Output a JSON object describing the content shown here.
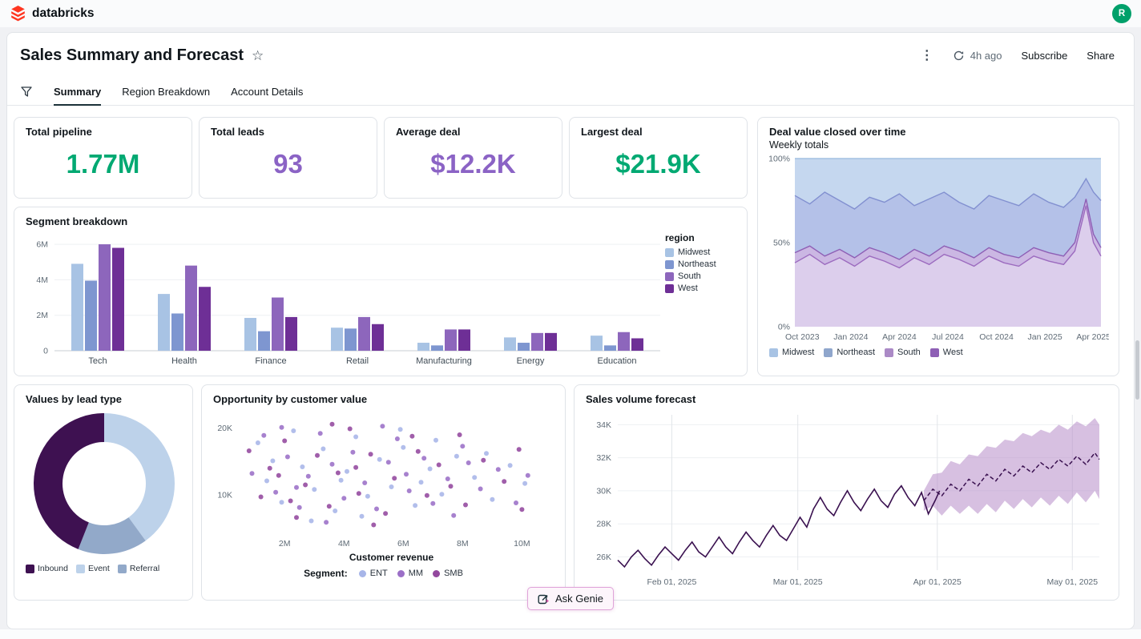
{
  "colors": {
    "brand_red": "#FF3621",
    "avatar_green": "#00A06A",
    "tab_underline": "#1B3139",
    "card_border": "#DFE3E8",
    "genie_border": "#DFA3D9",
    "genie_bg": "#FDF5FB",
    "text_primary": "#11171C",
    "text_secondary": "#5F6B76"
  },
  "topbar": {
    "brand": "databricks",
    "avatar_initial": "R"
  },
  "header": {
    "title": "Sales Summary and Forecast",
    "refreshed": "4h ago",
    "subscribe": "Subscribe",
    "share": "Share"
  },
  "tabs": [
    {
      "label": "Summary"
    },
    {
      "label": "Region Breakdown"
    },
    {
      "label": "Account Details"
    }
  ],
  "kpis": [
    {
      "title": "Total pipeline",
      "value": "1.77M",
      "color": "#00A972"
    },
    {
      "title": "Total leads",
      "value": "93",
      "color": "#8B63C5"
    },
    {
      "title": "Average deal",
      "value": "$12.2K",
      "color": "#8B63C5"
    },
    {
      "title": "Largest deal",
      "value": "$21.9K",
      "color": "#00A972"
    }
  ],
  "ask_genie": {
    "label": "Ask Genie"
  },
  "chart_data": [
    {
      "id": "segment-breakdown",
      "type": "bar",
      "title": "Segment breakdown",
      "legend_title": "region",
      "categories": [
        "Tech",
        "Health",
        "Finance",
        "Retail",
        "Manufacturing",
        "Energy",
        "Education"
      ],
      "series": [
        {
          "name": "Midwest",
          "color": "#A8C3E4",
          "values": [
            4.9,
            3.2,
            1.85,
            1.3,
            0.45,
            0.75,
            0.85
          ]
        },
        {
          "name": "Northeast",
          "color": "#7E96D0",
          "values": [
            3.95,
            2.1,
            1.1,
            1.25,
            0.3,
            0.45,
            0.3
          ]
        },
        {
          "name": "South",
          "color": "#8D66BC",
          "values": [
            6.0,
            4.8,
            3.0,
            1.9,
            1.2,
            1.0,
            1.05
          ]
        },
        {
          "name": "West",
          "color": "#6E2F96",
          "values": [
            5.8,
            3.6,
            1.9,
            1.5,
            1.2,
            1.0,
            0.7
          ]
        }
      ],
      "y_ticks": [
        0,
        2,
        4,
        6
      ],
      "y_tick_labels": [
        "0",
        "2M",
        "4M",
        "6M"
      ],
      "ylim": [
        0,
        6.5
      ]
    },
    {
      "id": "deal-value-closed",
      "type": "area",
      "title": "Deal value closed over time",
      "subtitle": "Weekly totals",
      "stack_bottom_to_top": [
        "West",
        "South",
        "Northeast",
        "Midwest"
      ],
      "x": [
        0,
        4,
        8,
        12,
        16,
        20,
        24,
        28,
        32,
        36,
        40,
        44,
        48,
        52,
        56,
        60,
        64,
        68,
        72,
        75,
        78,
        80,
        82
      ],
      "cum": {
        "west_top": [
          0.38,
          0.43,
          0.37,
          0.41,
          0.36,
          0.42,
          0.39,
          0.35,
          0.41,
          0.37,
          0.43,
          0.4,
          0.36,
          0.42,
          0.38,
          0.36,
          0.42,
          0.39,
          0.37,
          0.45,
          0.72,
          0.5,
          0.42
        ],
        "south_top": [
          0.44,
          0.48,
          0.42,
          0.46,
          0.41,
          0.47,
          0.44,
          0.4,
          0.46,
          0.42,
          0.48,
          0.45,
          0.41,
          0.47,
          0.43,
          0.41,
          0.47,
          0.44,
          0.42,
          0.5,
          0.76,
          0.55,
          0.47
        ],
        "northeast_top": [
          0.78,
          0.73,
          0.8,
          0.75,
          0.7,
          0.77,
          0.74,
          0.79,
          0.72,
          0.76,
          0.8,
          0.74,
          0.7,
          0.78,
          0.75,
          0.72,
          0.79,
          0.74,
          0.71,
          0.77,
          0.88,
          0.8,
          0.75
        ]
      },
      "xlim": [
        0,
        82
      ],
      "x_ticks": [
        {
          "pos": 2,
          "label": "Oct 2023"
        },
        {
          "pos": 15,
          "label": "Jan 2024"
        },
        {
          "pos": 28,
          "label": "Apr 2024"
        },
        {
          "pos": 41,
          "label": "Jul 2024"
        },
        {
          "pos": 54,
          "label": "Oct 2024"
        },
        {
          "pos": 67,
          "label": "Jan 2025"
        },
        {
          "pos": 80,
          "label": "Apr 2025"
        }
      ],
      "y_tick_labels": [
        "0%",
        "50%",
        "100%"
      ],
      "band_fills": [
        "#DCCEEC",
        "#CBB7E3",
        "#B4C1E8",
        "#C5D7EF"
      ],
      "band_strokes": [
        "#9C6BBF",
        "#8E5FB5",
        "#8290D0",
        "#A4C0E2"
      ],
      "legend": [
        {
          "label": "Midwest",
          "color": "#A8C3E4"
        },
        {
          "label": "Northeast",
          "color": "#8FA6CC"
        },
        {
          "label": "South",
          "color": "#AB8AC6"
        },
        {
          "label": "West",
          "color": "#8E5FB5"
        }
      ]
    },
    {
      "id": "values-by-lead-type",
      "type": "pie",
      "title": "Values by lead type",
      "slices": [
        {
          "label": "Inbound",
          "value": 44,
          "color": "#3E1151"
        },
        {
          "label": "Event",
          "value": 40,
          "color": "#BDD2EA"
        },
        {
          "label": "Referral",
          "value": 16,
          "color": "#92A9C9"
        }
      ],
      "draw_order": [
        1,
        2,
        0
      ]
    },
    {
      "id": "opportunity-by-customer-value",
      "type": "scatter",
      "title": "Opportunity by customer value",
      "xlabel": "Customer revenue",
      "legend_label": "Segment:",
      "xlim": [
        0.4,
        10.8
      ],
      "ylim": [
        4,
        22
      ],
      "x_ticks": [
        2,
        4,
        6,
        8,
        10
      ],
      "x_tick_labels": [
        "2M",
        "4M",
        "6M",
        "8M",
        "10M"
      ],
      "y_ticks": [
        10,
        20
      ],
      "y_tick_labels": [
        "10K",
        "20K"
      ],
      "segments": [
        {
          "name": "ENT",
          "color": "#A7B5E8"
        },
        {
          "name": "MM",
          "color": "#9B6FC7"
        },
        {
          "name": "SMB",
          "color": "#93489E"
        }
      ],
      "points": [
        [
          1.1,
          17.8,
          0
        ],
        [
          0.9,
          13.2,
          1
        ],
        [
          0.8,
          16.6,
          2
        ],
        [
          1.4,
          12.1,
          0
        ],
        [
          1.3,
          18.9,
          1
        ],
        [
          1.2,
          9.7,
          2
        ],
        [
          1.9,
          8.9,
          0
        ],
        [
          1.7,
          10.4,
          1
        ],
        [
          1.5,
          14.0,
          2
        ],
        [
          2.3,
          19.6,
          0
        ],
        [
          2.1,
          15.7,
          1
        ],
        [
          2.0,
          18.1,
          2
        ],
        [
          2.6,
          14.2,
          0
        ],
        [
          2.5,
          8.1,
          1
        ],
        [
          2.4,
          6.6,
          2
        ],
        [
          3.0,
          10.8,
          0
        ],
        [
          2.8,
          12.8,
          1
        ],
        [
          2.7,
          11.5,
          2
        ],
        [
          3.3,
          16.9,
          0
        ],
        [
          3.2,
          19.2,
          1
        ],
        [
          3.1,
          15.9,
          2
        ],
        [
          3.7,
          7.6,
          0
        ],
        [
          3.6,
          14.6,
          1
        ],
        [
          3.5,
          8.3,
          2
        ],
        [
          4.1,
          13.5,
          0
        ],
        [
          4.0,
          9.5,
          1
        ],
        [
          3.8,
          13.3,
          2
        ],
        [
          4.4,
          18.7,
          0
        ],
        [
          4.3,
          16.4,
          1
        ],
        [
          4.2,
          19.9,
          2
        ],
        [
          4.8,
          9.8,
          0
        ],
        [
          4.7,
          11.8,
          1
        ],
        [
          4.5,
          10.2,
          2
        ],
        [
          5.2,
          15.3,
          0
        ],
        [
          5.1,
          7.9,
          1
        ],
        [
          4.9,
          16.1,
          2
        ],
        [
          5.6,
          11.2,
          0
        ],
        [
          5.5,
          14.9,
          1
        ],
        [
          5.4,
          7.2,
          2
        ],
        [
          6.0,
          17.1,
          0
        ],
        [
          5.8,
          18.4,
          1
        ],
        [
          5.7,
          12.5,
          2
        ],
        [
          6.4,
          8.4,
          0
        ],
        [
          6.2,
          10.6,
          1
        ],
        [
          6.3,
          18.8,
          2
        ],
        [
          6.9,
          13.9,
          0
        ],
        [
          6.7,
          15.5,
          1
        ],
        [
          6.8,
          9.9,
          2
        ],
        [
          7.3,
          10.1,
          0
        ],
        [
          7.0,
          8.7,
          1
        ],
        [
          7.2,
          14.5,
          2
        ],
        [
          7.8,
          15.8,
          0
        ],
        [
          7.5,
          12.4,
          1
        ],
        [
          7.6,
          11.3,
          2
        ],
        [
          8.4,
          12.6,
          0
        ],
        [
          8.0,
          17.3,
          1
        ],
        [
          8.1,
          8.5,
          2
        ],
        [
          9.0,
          9.3,
          0
        ],
        [
          8.6,
          10.9,
          1
        ],
        [
          8.7,
          15.2,
          2
        ],
        [
          9.6,
          14.4,
          0
        ],
        [
          9.2,
          13.8,
          1
        ],
        [
          9.4,
          12.0,
          2
        ],
        [
          10.1,
          11.7,
          0
        ],
        [
          9.8,
          8.8,
          1
        ],
        [
          9.9,
          16.8,
          2
        ],
        [
          2.9,
          6.1,
          0
        ],
        [
          10.2,
          12.9,
          1
        ],
        [
          10.0,
          7.8,
          2
        ],
        [
          5.9,
          19.8,
          0
        ],
        [
          1.9,
          20.1,
          1
        ],
        [
          1.8,
          12.9,
          2
        ],
        [
          7.1,
          18.2,
          0
        ],
        [
          3.4,
          5.9,
          1
        ],
        [
          3.6,
          20.6,
          2
        ],
        [
          3.9,
          12.2,
          0
        ],
        [
          5.3,
          20.3,
          1
        ],
        [
          5.0,
          5.5,
          2
        ],
        [
          1.6,
          15.1,
          0
        ],
        [
          7.7,
          6.9,
          1
        ],
        [
          6.5,
          16.5,
          2
        ],
        [
          8.8,
          16.2,
          0
        ],
        [
          2.4,
          11.1,
          1
        ],
        [
          7.9,
          19.0,
          2
        ],
        [
          4.6,
          6.8,
          0
        ],
        [
          6.1,
          13.1,
          1
        ],
        [
          2.2,
          9.1,
          2
        ],
        [
          6.6,
          11.9,
          0
        ],
        [
          8.2,
          14.8,
          1
        ],
        [
          4.4,
          14.1,
          2
        ]
      ]
    },
    {
      "id": "sales-volume-forecast",
      "type": "line",
      "title": "Sales volume forecast",
      "xlim": [
        0,
        107
      ],
      "ylim": [
        25.2,
        34.6
      ],
      "y_ticks": [
        26,
        28,
        30,
        32,
        34
      ],
      "y_tick_labels": [
        "26K",
        "28K",
        "30K",
        "32K",
        "34K"
      ],
      "x_ticks": [
        {
          "pos": 12,
          "label": "Feb 01, 2025"
        },
        {
          "pos": 40,
          "label": "Mar 01, 2025"
        },
        {
          "pos": 71,
          "label": "Apr 01, 2025"
        },
        {
          "pos": 101,
          "label": "May 01, 2025"
        }
      ],
      "line_color": "#3A1150",
      "band_color": "#B78CC8",
      "band_opacity": 0.55,
      "history": [
        [
          0,
          25.8
        ],
        [
          1.5,
          25.4
        ],
        [
          3,
          26.0
        ],
        [
          4.5,
          26.4
        ],
        [
          6,
          25.9
        ],
        [
          7.5,
          25.5
        ],
        [
          9,
          26.1
        ],
        [
          10.5,
          26.6
        ],
        [
          12,
          26.2
        ],
        [
          13.5,
          25.8
        ],
        [
          15,
          26.4
        ],
        [
          16.5,
          26.9
        ],
        [
          18,
          26.3
        ],
        [
          19.5,
          26.0
        ],
        [
          21,
          26.6
        ],
        [
          22.5,
          27.2
        ],
        [
          24,
          26.6
        ],
        [
          25.5,
          26.2
        ],
        [
          27,
          26.9
        ],
        [
          28.5,
          27.5
        ],
        [
          30,
          27.0
        ],
        [
          31.5,
          26.6
        ],
        [
          33,
          27.3
        ],
        [
          34.5,
          27.9
        ],
        [
          36,
          27.3
        ],
        [
          37.5,
          27.0
        ],
        [
          39,
          27.7
        ],
        [
          40.5,
          28.4
        ],
        [
          42,
          27.8
        ],
        [
          43.5,
          28.9
        ],
        [
          45,
          29.6
        ],
        [
          46.5,
          28.9
        ],
        [
          48,
          28.5
        ],
        [
          49.5,
          29.3
        ],
        [
          51,
          30.0
        ],
        [
          52.5,
          29.3
        ],
        [
          54,
          28.8
        ],
        [
          55.5,
          29.5
        ],
        [
          57,
          30.1
        ],
        [
          58.5,
          29.4
        ],
        [
          60,
          29.0
        ],
        [
          61.5,
          29.8
        ],
        [
          63,
          30.3
        ],
        [
          64.5,
          29.6
        ],
        [
          66,
          29.1
        ],
        [
          67.5,
          29.9
        ],
        [
          69,
          28.6
        ],
        [
          70.5,
          29.4
        ],
        [
          71.5,
          30.0
        ]
      ],
      "forecast": [
        [
          68,
          29.4,
          28.8,
          30.0
        ],
        [
          70,
          30.1,
          29.1,
          31.0
        ],
        [
          72,
          29.7,
          28.5,
          31.1
        ],
        [
          74,
          30.4,
          29.1,
          31.8
        ],
        [
          76,
          30.0,
          28.6,
          31.6
        ],
        [
          78,
          30.7,
          29.1,
          32.2
        ],
        [
          80,
          30.3,
          28.6,
          32.1
        ],
        [
          82,
          31.0,
          29.2,
          32.7
        ],
        [
          84,
          30.6,
          28.7,
          32.6
        ],
        [
          86,
          31.3,
          29.4,
          33.1
        ],
        [
          88,
          30.9,
          28.9,
          33.0
        ],
        [
          90,
          31.5,
          29.5,
          33.5
        ],
        [
          92,
          31.1,
          29.0,
          33.3
        ],
        [
          94,
          31.7,
          29.6,
          33.7
        ],
        [
          96,
          31.3,
          29.1,
          33.5
        ],
        [
          98,
          31.9,
          29.7,
          34.0
        ],
        [
          100,
          31.5,
          29.2,
          33.7
        ],
        [
          102,
          32.1,
          29.9,
          34.2
        ],
        [
          104,
          31.6,
          29.3,
          33.9
        ],
        [
          106,
          32.3,
          30.0,
          34.4
        ],
        [
          107,
          31.9,
          29.5,
          34.0
        ]
      ]
    }
  ]
}
